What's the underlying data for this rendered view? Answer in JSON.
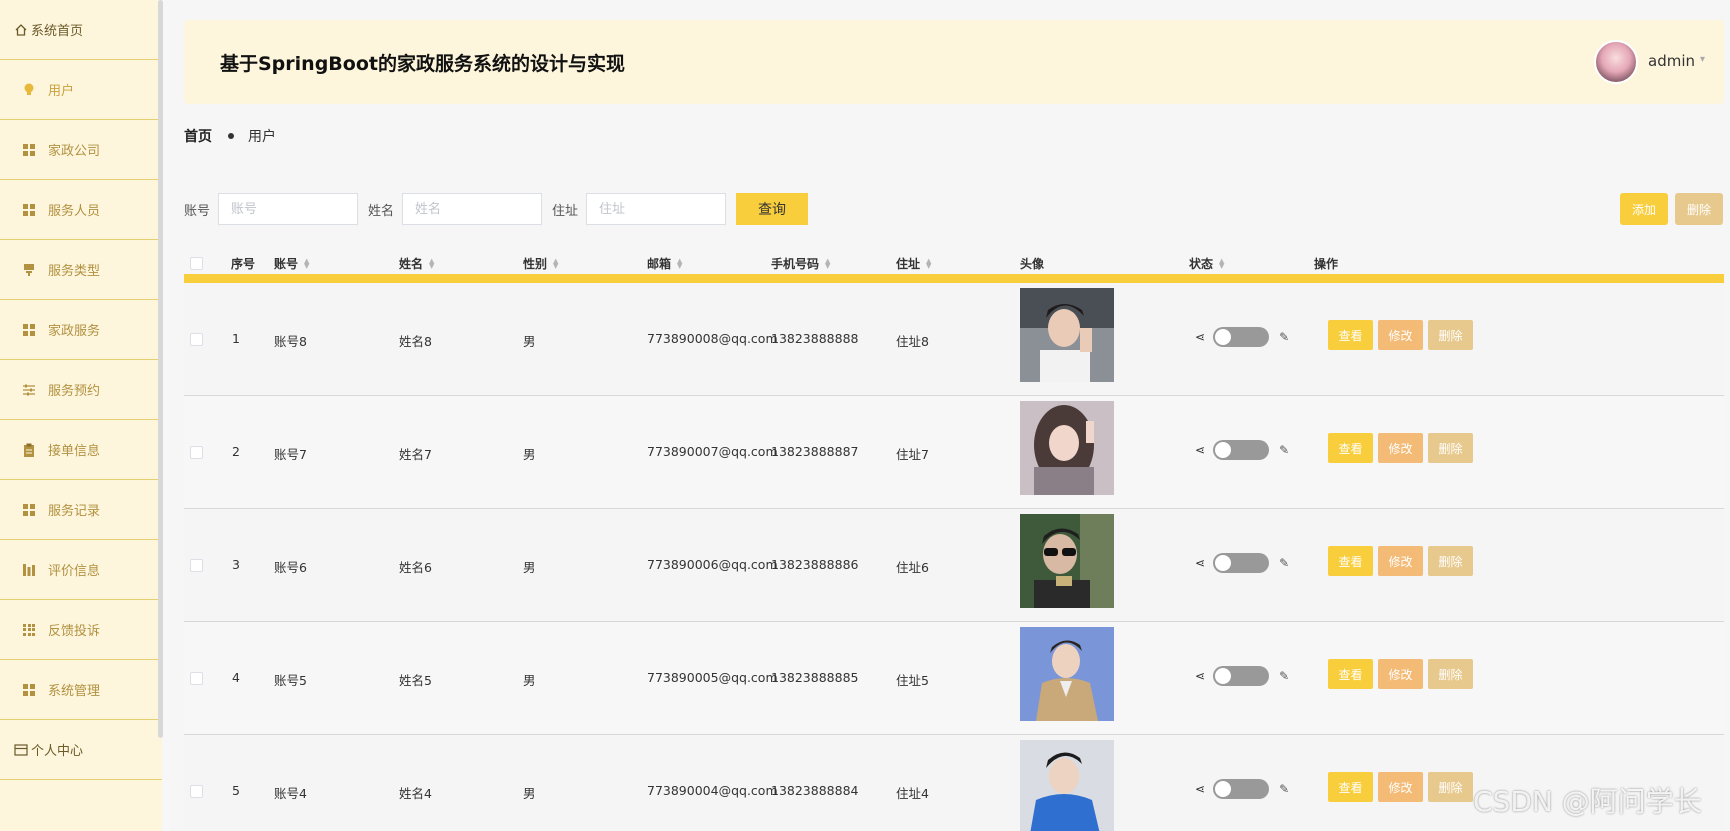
{
  "sidebar": {
    "items": [
      {
        "label": "系统首页",
        "icon": "home-icon"
      },
      {
        "label": "用户",
        "icon": "bulb-icon",
        "active": true
      },
      {
        "label": "家政公司",
        "icon": "grid-icon"
      },
      {
        "label": "服务人员",
        "icon": "grid-icon"
      },
      {
        "label": "服务类型",
        "icon": "pin-icon"
      },
      {
        "label": "家政服务",
        "icon": "grid-icon"
      },
      {
        "label": "服务预约",
        "icon": "sliders-icon"
      },
      {
        "label": "接单信息",
        "icon": "clipboard-icon"
      },
      {
        "label": "服务记录",
        "icon": "grid-icon"
      },
      {
        "label": "评价信息",
        "icon": "chart-icon"
      },
      {
        "label": "反馈投诉",
        "icon": "grid9-icon"
      },
      {
        "label": "系统管理",
        "icon": "grid-icon"
      },
      {
        "label": "个人中心",
        "icon": "card-icon"
      }
    ]
  },
  "header": {
    "title": "基于SpringBoot的家政服务系统的设计与实现",
    "user": "admin"
  },
  "breadcrumb": {
    "home": "首页",
    "current": "用户"
  },
  "search": {
    "account_label": "账号",
    "account_placeholder": "账号",
    "name_label": "姓名",
    "name_placeholder": "姓名",
    "address_label": "住址",
    "address_placeholder": "住址",
    "query_label": "查询"
  },
  "actions": {
    "add_label": "添加",
    "delete_label": "删除"
  },
  "table": {
    "columns": {
      "index": "序号",
      "account": "账号",
      "name": "姓名",
      "gender": "性别",
      "email": "邮箱",
      "phone": "手机号码",
      "address": "住址",
      "avatar": "头像",
      "status": "状态",
      "ops": "操作"
    },
    "op_labels": {
      "view": "查看",
      "edit": "修改",
      "delete": "删除"
    },
    "rows": [
      {
        "index": "1",
        "account": "账号8",
        "name": "姓名8",
        "gender": "男",
        "email": "773890008@qq.com",
        "phone": "13823888888",
        "address": "住址8"
      },
      {
        "index": "2",
        "account": "账号7",
        "name": "姓名7",
        "gender": "男",
        "email": "773890007@qq.com",
        "phone": "13823888887",
        "address": "住址7"
      },
      {
        "index": "3",
        "account": "账号6",
        "name": "姓名6",
        "gender": "男",
        "email": "773890006@qq.com",
        "phone": "13823888886",
        "address": "住址6"
      },
      {
        "index": "4",
        "account": "账号5",
        "name": "姓名5",
        "gender": "男",
        "email": "773890005@qq.com",
        "phone": "13823888885",
        "address": "住址5"
      },
      {
        "index": "5",
        "account": "账号4",
        "name": "姓名4",
        "gender": "男",
        "email": "773890004@qq.com",
        "phone": "13823888884",
        "address": "住址4"
      }
    ]
  },
  "watermark": "CSDN @阿问学长",
  "colors": {
    "accent": "#f9ce3c",
    "sidebar_bg": "#fdf6dd",
    "edit_btn": "#f4bb76",
    "delete_btn": "#e8c98d"
  }
}
